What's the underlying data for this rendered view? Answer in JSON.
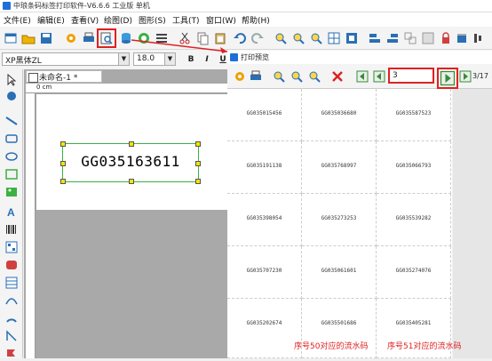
{
  "app": {
    "title": "中琅条码标签打印软件-V6.6.6 工业版 单机"
  },
  "menu": [
    "文件(E)",
    "编辑(E)",
    "查看(V)",
    "绘图(D)",
    "图形(S)",
    "工具(T)",
    "窗口(W)",
    "帮助(H)"
  ],
  "fontbar": {
    "font_name": "XP黑体ZL",
    "font_size": "18.0",
    "bold": "B",
    "italic": "I",
    "underline": "U"
  },
  "document": {
    "tab_label": "未命名-1 *",
    "ruler_zero": "0 cm",
    "barcode_value": "GG035163611"
  },
  "preview": {
    "title": "打印预览",
    "page_input": "3",
    "page_count": "3/17",
    "cells": [
      [
        "GG035015456",
        "GG035036680",
        "GG035587523"
      ],
      [
        "GG035191138",
        "GG035768997",
        "GG035066793"
      ],
      [
        "GG035398054",
        "GG035273253",
        "GG035539282"
      ],
      [
        "GG035707230",
        "GG035061601",
        "GG035274076"
      ],
      [
        "GG035202674",
        "GG035501686",
        "GG035405281"
      ]
    ],
    "annotation_left": "序号50对应的流水码",
    "annotation_right": "序号51对应的流水码"
  },
  "colors": {
    "accent_red": "#e02020",
    "selection_green": "#3cb043",
    "handle_yellow": "#f5e400",
    "app_blue": "#1e6fd9"
  }
}
